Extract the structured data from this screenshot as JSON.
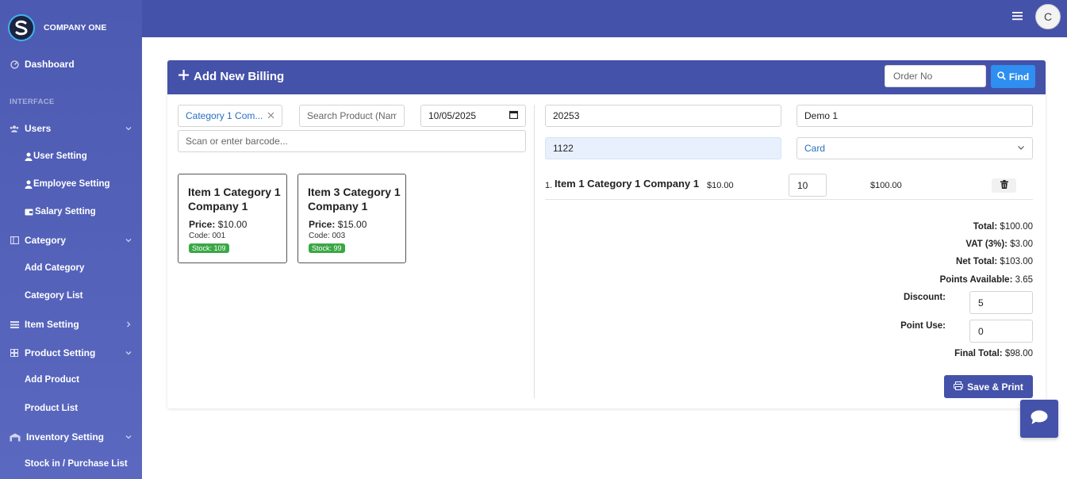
{
  "brand": {
    "name": "COMPANY ONE"
  },
  "sidebar": {
    "dashboard": "Dashboard",
    "section_interface": "INTERFACE",
    "users": "Users",
    "user_setting": "User Setting",
    "employee_setting": "Employee Setting",
    "salary_setting": "Salary Setting",
    "category": "Category",
    "add_category": "Add Category",
    "category_list": "Category List",
    "item_setting": "Item Setting",
    "product_setting": "Product Setting",
    "add_product": "Add Product",
    "product_list": "Product List",
    "inventory_setting": "Inventory Setting",
    "stock_in": "Stock in / Purchase List"
  },
  "topbar": {
    "avatar_letter": "C"
  },
  "billing": {
    "title": "Add New Billing",
    "order_placeholder": "Order No",
    "find_label": "Find",
    "category_filter": "Category 1 Com...",
    "search_placeholder": "Search Product (Name...",
    "date": "10/05/2025",
    "barcode_placeholder": "Scan or enter barcode...",
    "invoice_no": "20253",
    "customer": "Demo 1",
    "phone": "1122",
    "payment_method": "Card"
  },
  "products": [
    {
      "name": "Item 1 Category 1 Company 1",
      "price_label": "Price:",
      "price": "$10.00",
      "code": "Code: 001",
      "stock": "Stock: 109"
    },
    {
      "name": "Item 3 Category 1 Company 1",
      "price_label": "Price:",
      "price": "$15.00",
      "code": "Code: 003",
      "stock": "Stock: 99"
    }
  ],
  "cart": {
    "items": [
      {
        "index": "1.",
        "name": "Item 1 Category 1 Company 1",
        "unit_price": "$10.00",
        "qty": "10",
        "line_total": "$100.00"
      }
    ]
  },
  "summary": {
    "total_label": "Total:",
    "total": "$100.00",
    "vat_label": "VAT (3%):",
    "vat": "$3.00",
    "net_label": "Net Total:",
    "net": "$103.00",
    "points_label": "Points Available:",
    "points": "3.65",
    "discount_label": "Discount:",
    "discount": "5",
    "point_use_label": "Point Use:",
    "point_use": "0",
    "final_label": "Final Total:",
    "final": "$98.00"
  },
  "actions": {
    "save_print": "Save & Print"
  },
  "colors": {
    "primary": "#4552a9",
    "find": "#2e8ff0",
    "stock": "#3aa745"
  }
}
